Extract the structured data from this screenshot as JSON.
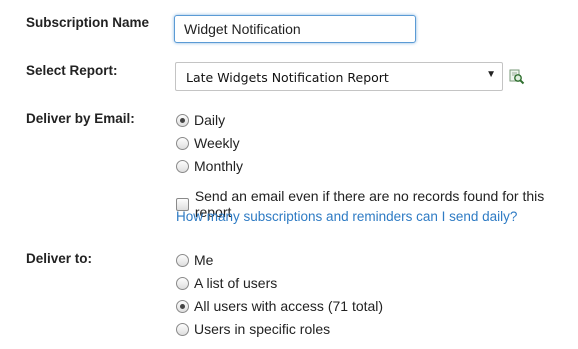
{
  "subscription_name": {
    "label": "Subscription Name",
    "value": "Widget Notification"
  },
  "select_report": {
    "label": "Select Report:",
    "selected": "Late Widgets Notification Report",
    "lookup_icon": "magnifier-lookup-icon"
  },
  "deliver_by_email": {
    "label": "Deliver by Email:",
    "options": [
      {
        "label": "Daily",
        "checked": true
      },
      {
        "label": "Weekly",
        "checked": false
      },
      {
        "label": "Monthly",
        "checked": false
      }
    ],
    "no_records_checkbox": {
      "label": "Send an email even if there are no records found for this report",
      "checked": false
    },
    "help_link": "How many subscriptions and reminders can I send daily?"
  },
  "deliver_to": {
    "label": "Deliver to:",
    "options": [
      {
        "label": "Me",
        "checked": false
      },
      {
        "label": "A list of users",
        "checked": false
      },
      {
        "label": "All users with access (71 total)",
        "checked": true
      },
      {
        "label": "Users in specific roles",
        "checked": false
      }
    ]
  },
  "colors": {
    "link": "#2e7bc4",
    "focus_border": "#5b9bd5"
  }
}
